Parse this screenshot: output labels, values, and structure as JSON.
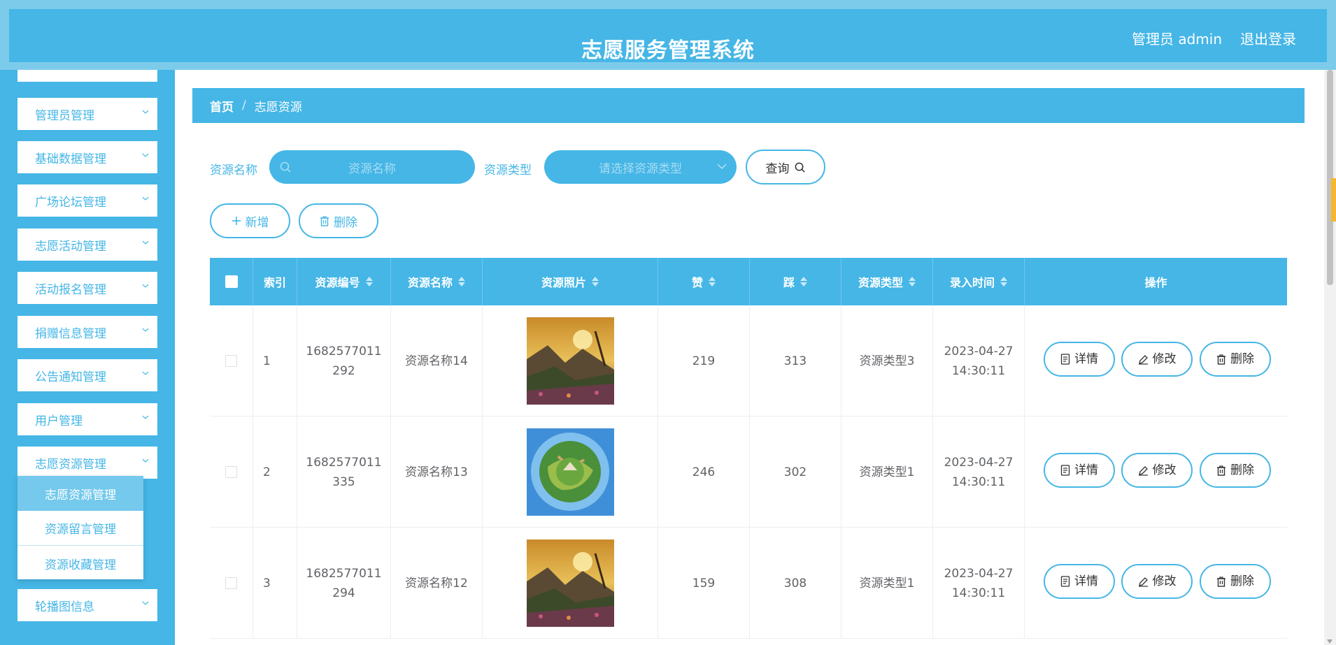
{
  "header": {
    "title": "志愿服务管理系统",
    "user": "管理员 admin",
    "logout": "退出登录"
  },
  "sidebar": {
    "items": [
      {
        "label": "管理员管理"
      },
      {
        "label": "基础数据管理"
      },
      {
        "label": "广场论坛管理"
      },
      {
        "label": "志愿活动管理"
      },
      {
        "label": "活动报名管理"
      },
      {
        "label": "捐赠信息管理"
      },
      {
        "label": "公告通知管理"
      },
      {
        "label": "用户管理"
      },
      {
        "label": "志愿资源管理"
      },
      {
        "label": "轮播图信息"
      }
    ],
    "submenu": [
      {
        "label": "志愿资源管理",
        "active": true
      },
      {
        "label": "资源留言管理"
      },
      {
        "label": "资源收藏管理"
      }
    ]
  },
  "breadcrumb": {
    "home": "首页",
    "separator": "/",
    "current": "志愿资源"
  },
  "filters": {
    "name_label": "资源名称",
    "name_placeholder": "资源名称",
    "type_label": "资源类型",
    "type_placeholder": "请选择资源类型",
    "query_label": "查询"
  },
  "toolbar": {
    "add_label": "新增",
    "delete_label": "删除"
  },
  "table": {
    "columns": {
      "index": "索引",
      "code": "资源编号",
      "name": "资源名称",
      "photo": "资源照片",
      "likes": "赞",
      "dislikes": "踩",
      "type": "资源类型",
      "time": "录入时间",
      "actions": "操作"
    },
    "actions": {
      "detail": "详情",
      "edit": "修改",
      "delete": "删除"
    },
    "rows": [
      {
        "index": "1",
        "code": "1682577011292",
        "name": "资源名称14",
        "photo": "mountain-sunset",
        "likes": "219",
        "dislikes": "313",
        "type": "资源类型3",
        "time": "2023-04-27 14:30:11"
      },
      {
        "index": "2",
        "code": "1682577011335",
        "name": "资源名称13",
        "photo": "tiny-planet",
        "likes": "246",
        "dislikes": "302",
        "type": "资源类型1",
        "time": "2023-04-27 14:30:11"
      },
      {
        "index": "3",
        "code": "1682577011294",
        "name": "资源名称12",
        "photo": "mountain-sunset",
        "likes": "159",
        "dislikes": "308",
        "type": "资源类型1",
        "time": "2023-04-27 14:30:11"
      }
    ]
  },
  "colors": {
    "primary": "#45b6e6",
    "header_border": "#7dcbeb",
    "submenu_active": "#74c9ec"
  }
}
